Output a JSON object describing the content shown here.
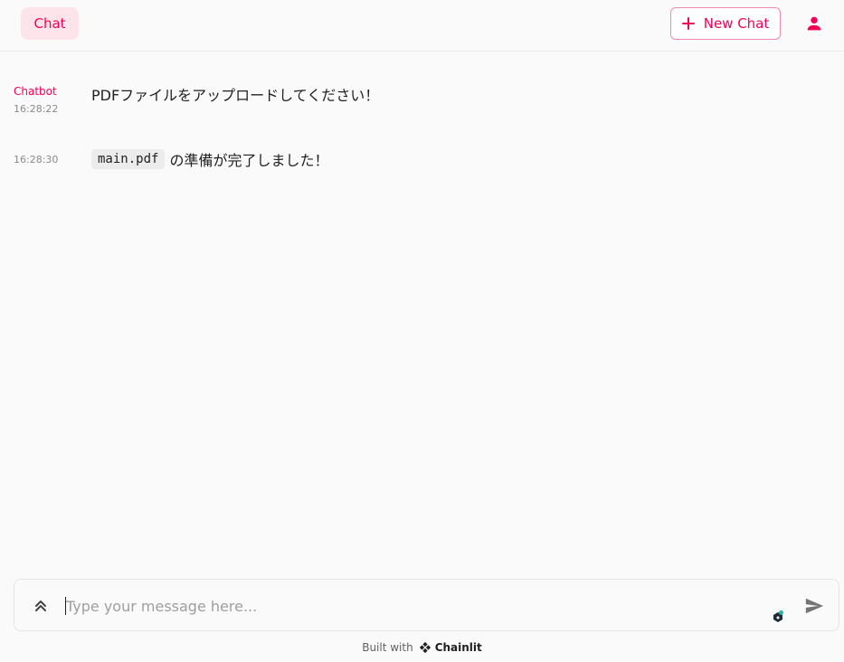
{
  "header": {
    "tab_label": "Chat",
    "new_chat_label": "New Chat",
    "accent_color": "#f50057"
  },
  "messages": [
    {
      "author": "Chatbot",
      "timestamp": "16:28:22",
      "text": "PDFファイルをアップロードしてください！"
    },
    {
      "author": "",
      "timestamp": "16:28:30",
      "file_name": "main.pdf",
      "text": "の準備が完了しました！"
    }
  ],
  "composer": {
    "placeholder": "Type your message here...",
    "value": ""
  },
  "footer": {
    "built_with": "Built with",
    "brand": "Chainlit"
  }
}
